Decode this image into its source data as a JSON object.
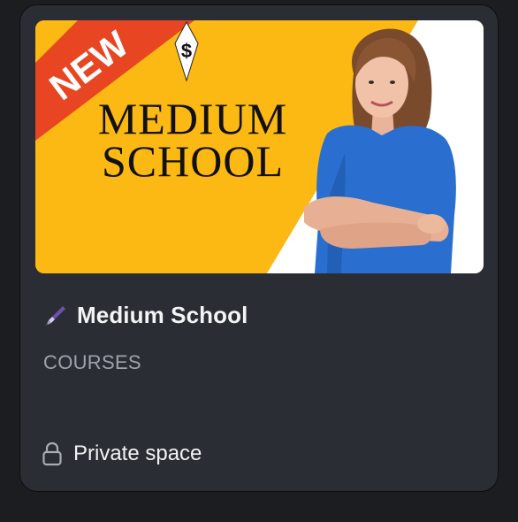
{
  "card": {
    "cover": {
      "badge_text": "NEW",
      "headline_line1": "MEDIUM",
      "headline_line2": "SCHOOL",
      "logo_symbol": "$"
    },
    "title_icon": "fountain-pen-icon",
    "title": "Medium School",
    "category": "COURSES",
    "privacy_icon": "lock-icon",
    "privacy_label": "Private space"
  },
  "colors": {
    "page_background": "#1b1d21",
    "card_background": "#2a2d33",
    "cover_yellow": "#fcb813",
    "badge_red": "#e84523",
    "dress_blue": "#2a6fcf"
  }
}
